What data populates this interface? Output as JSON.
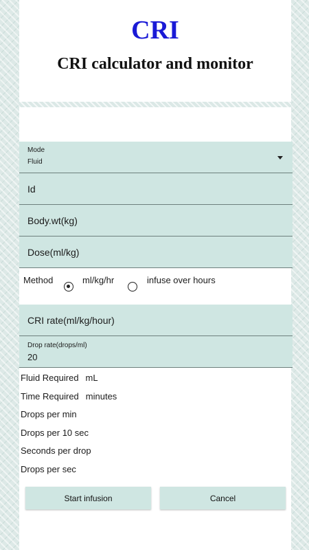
{
  "header": {
    "title": "CRI",
    "subtitle": "CRI calculator and monitor"
  },
  "mode": {
    "label": "Mode",
    "selected": "Fluid"
  },
  "fields": {
    "id": "Id",
    "body_wt": "Body.wt(kg)",
    "dose": "Dose(ml/kg)"
  },
  "method": {
    "label": "Method",
    "options": [
      "ml/kg/hr",
      "infuse over hours"
    ],
    "selected": "ml/kg/hr"
  },
  "cri_rate": {
    "label": "CRI rate(ml/kg/hour)"
  },
  "drop_rate": {
    "label": "Drop rate(drops/ml)",
    "value": "20"
  },
  "results": {
    "fluid_required": {
      "label": "Fluid Required",
      "unit": "mL"
    },
    "time_required": {
      "label": "Time Required",
      "unit": "minutes"
    },
    "drops_per_min": {
      "label": "Drops per min"
    },
    "drops_per_10_sec": {
      "label": "Drops per 10 sec"
    },
    "seconds_per_drop": {
      "label": "Seconds per drop"
    },
    "drops_per_sec": {
      "label": "Drops per sec"
    }
  },
  "buttons": {
    "start": "Start infusion",
    "cancel": "Cancel"
  },
  "colors": {
    "title": "#1a1ad6",
    "field_bg": "#cfe6e2",
    "background": "#dde9e7"
  }
}
